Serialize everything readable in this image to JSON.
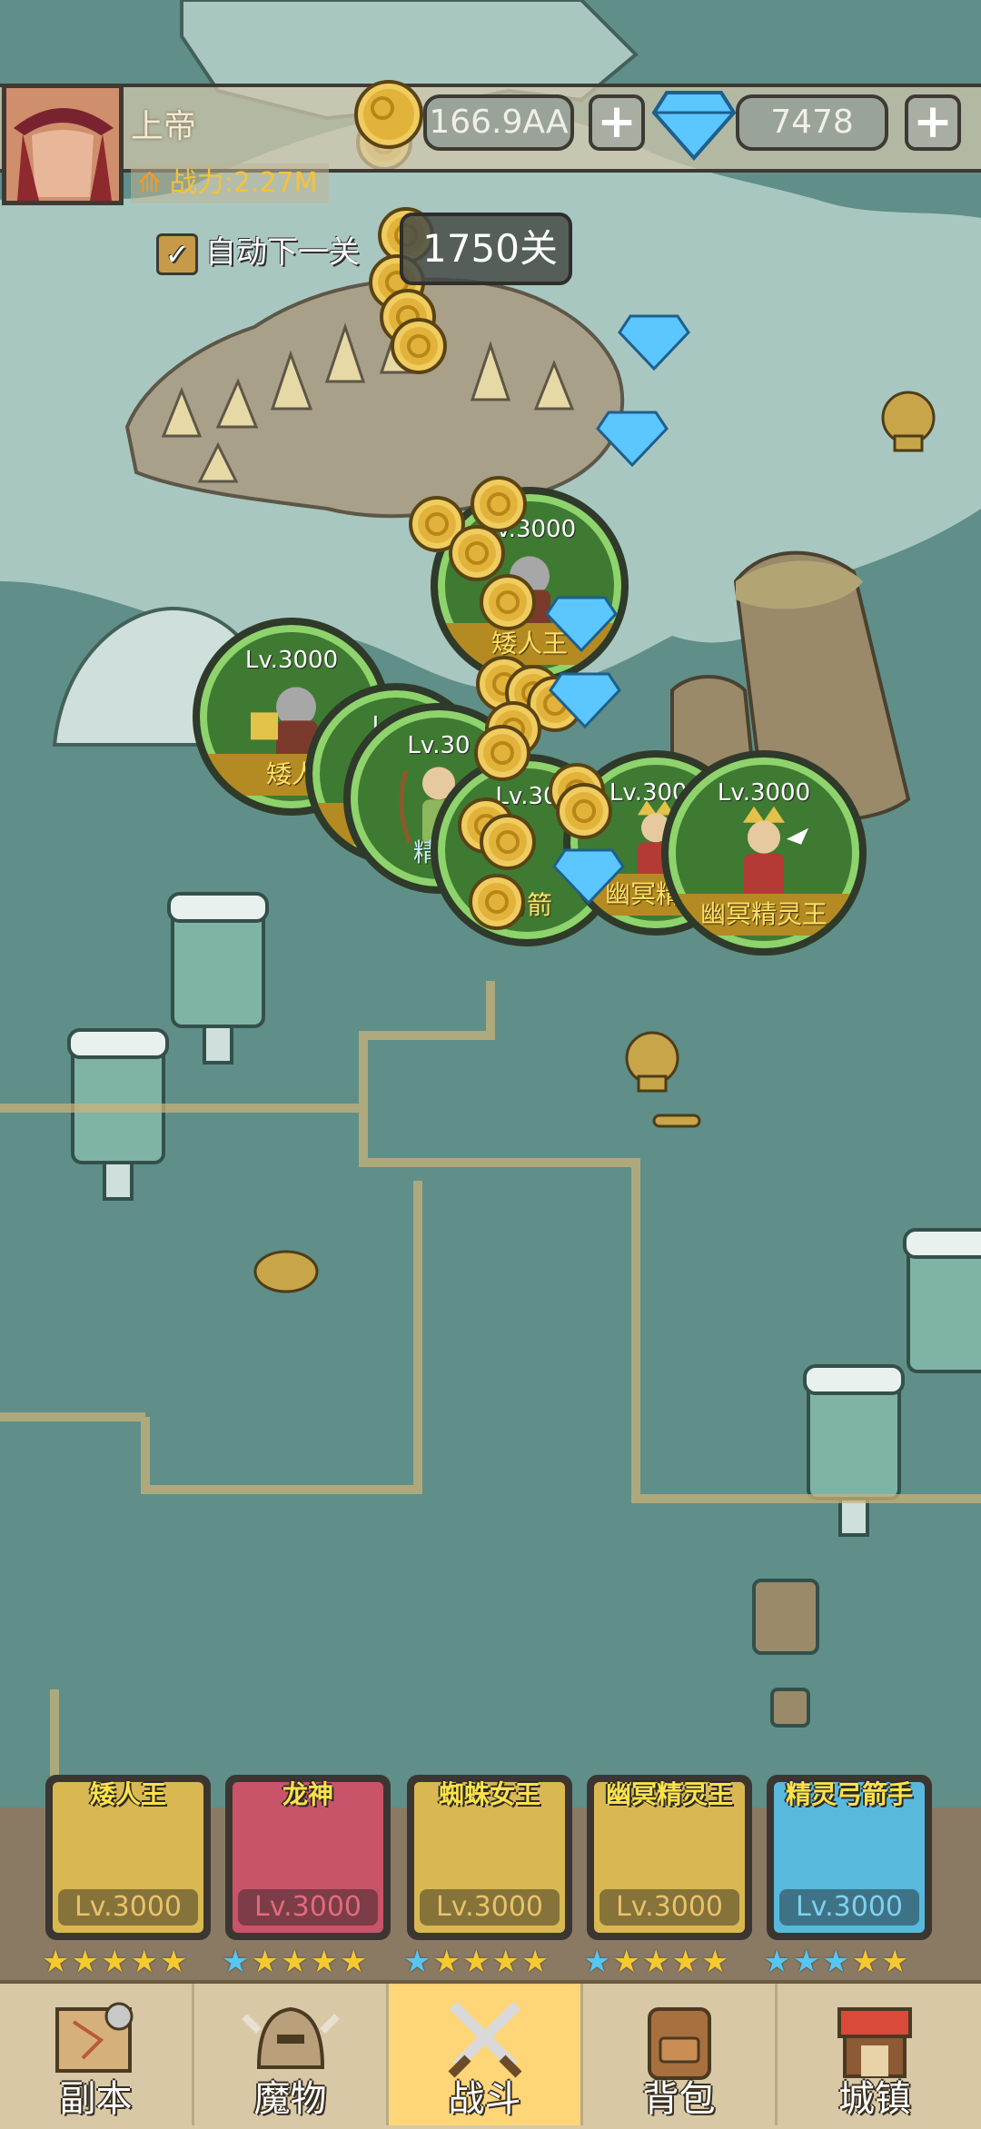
{
  "player": {
    "name": "上帝",
    "power_label": "战力:2.27M"
  },
  "currency": {
    "gold": "166.9AA",
    "gems": "7478",
    "add_symbol": "+"
  },
  "stage": {
    "auto_next_label": "自动下一关",
    "auto_next_checked": true,
    "stage_text": "1750关"
  },
  "battle_units": [
    {
      "level": "Lv.3000",
      "name": "矮人王"
    },
    {
      "level": "Lv.3000",
      "name": "矮人"
    },
    {
      "level": "Lv.3",
      "name": ""
    },
    {
      "level": "Lv.30",
      "name": "精灵"
    },
    {
      "level": "Lv.30",
      "name": "弓箭"
    },
    {
      "level": "Lv.3000",
      "name": "幽冥精灵"
    },
    {
      "level": "Lv.3000",
      "name": "幽冥精灵王"
    },
    {
      "level": "000",
      "name": ""
    }
  ],
  "hero_cards": [
    {
      "name": "矮人王",
      "level": "Lv.3000",
      "bg": "#d9b851",
      "level_color": "#e9c36a",
      "stars": "★★★★★",
      "star_color": "#f6c92f"
    },
    {
      "name": "龙神",
      "level": "Lv.3000",
      "bg": "#c9546a",
      "level_color": "#e26b7a",
      "stars": "★★★★★",
      "star_color": "#f6c92f",
      "first_star_color": "#57c6f0"
    },
    {
      "name": "蜘蛛女王",
      "level": "Lv.3000",
      "bg": "#d9b851",
      "level_color": "#e9c36a",
      "stars": "★★★★★",
      "star_color": "#f6c92f",
      "first_star_color": "#57c6f0"
    },
    {
      "name": "幽冥精灵王",
      "level": "Lv.3000",
      "bg": "#d9b851",
      "level_color": "#e9c36a",
      "stars": "★★★★★",
      "star_color": "#f6c92f",
      "first_star_color": "#57c6f0"
    },
    {
      "name": "精灵弓箭手",
      "level": "Lv.3000",
      "bg": "#58b9dc",
      "level_color": "#7fd2ef",
      "stars": "★★★★★",
      "star_color": "#f6c92f",
      "blue_count": 3
    }
  ],
  "nav": [
    {
      "label": "副本",
      "icon": "map-icon"
    },
    {
      "label": "魔物",
      "icon": "monster-helmet-icon"
    },
    {
      "label": "战斗",
      "icon": "crossed-swords-icon",
      "active": true
    },
    {
      "label": "背包",
      "icon": "backpack-icon"
    },
    {
      "label": "城镇",
      "icon": "town-shop-icon"
    }
  ],
  "colors": {
    "active_nav": "#ffd677",
    "nav_bg": "#d8c8a5",
    "map_bg": "#5f8f88"
  }
}
